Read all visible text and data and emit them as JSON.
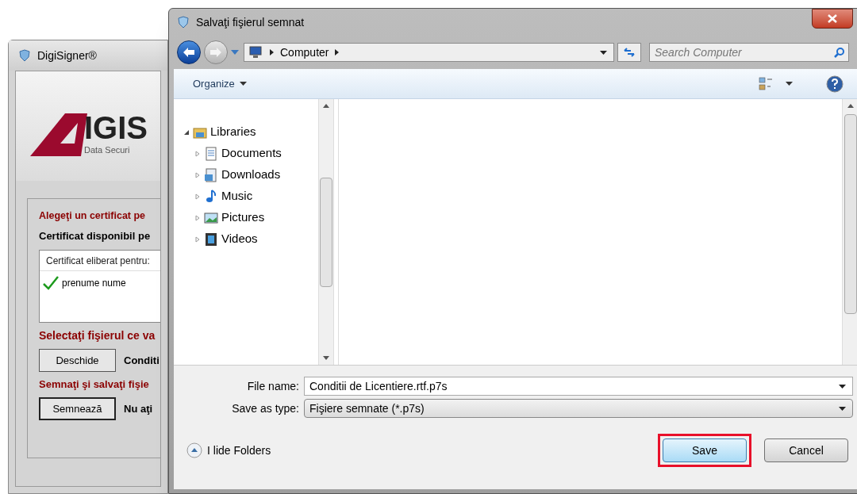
{
  "back_window": {
    "title": "DigiSigner®",
    "logo": {
      "mark": "IGIS",
      "tagline": "Data Securi"
    },
    "choose_label": "Alegeţi un certificat pe",
    "available_label": "Certificat disponibil pe",
    "cert_list": {
      "header": "Certificat eliberat pentru:",
      "items": [
        {
          "name": "prenume nume",
          "valid": true
        }
      ]
    },
    "select_label": "Selectaţi fişierul ce va",
    "open_button": "Deschide",
    "file_label": "Conditi",
    "sign_label": "Semnaţi şi salvaţi fişie",
    "sign_button": "Semnează",
    "status_label": "Nu aţi"
  },
  "dialog": {
    "title": "Salvaţi fişierul semnat",
    "address": [
      "Computer"
    ],
    "search": {
      "placeholder": "Search Computer"
    },
    "toolbar": {
      "organize": "Organize"
    },
    "nav_tree": [
      {
        "label": "Libraries",
        "kind": "libraries",
        "expanded": true,
        "children": [
          {
            "label": "Documents",
            "kind": "documents",
            "expanded": false
          },
          {
            "label": "Downloads",
            "kind": "downloads",
            "expanded": false
          },
          {
            "label": "Music",
            "kind": "music",
            "expanded": false
          },
          {
            "label": "Pictures",
            "kind": "pictures",
            "expanded": false
          },
          {
            "label": "Videos",
            "kind": "videos",
            "expanded": false
          }
        ]
      }
    ],
    "file_name": {
      "label": "File name:",
      "value": "Conditii de Licentiere.rtf.p7s"
    },
    "save_type": {
      "label": "Save as type:",
      "value": "Fişiere semnate (*.p7s)"
    },
    "hide_folders": "I lide Folders",
    "buttons": [
      {
        "label": "Save",
        "highlighted": true
      },
      {
        "label": "Cancel",
        "highlighted": false
      }
    ]
  }
}
